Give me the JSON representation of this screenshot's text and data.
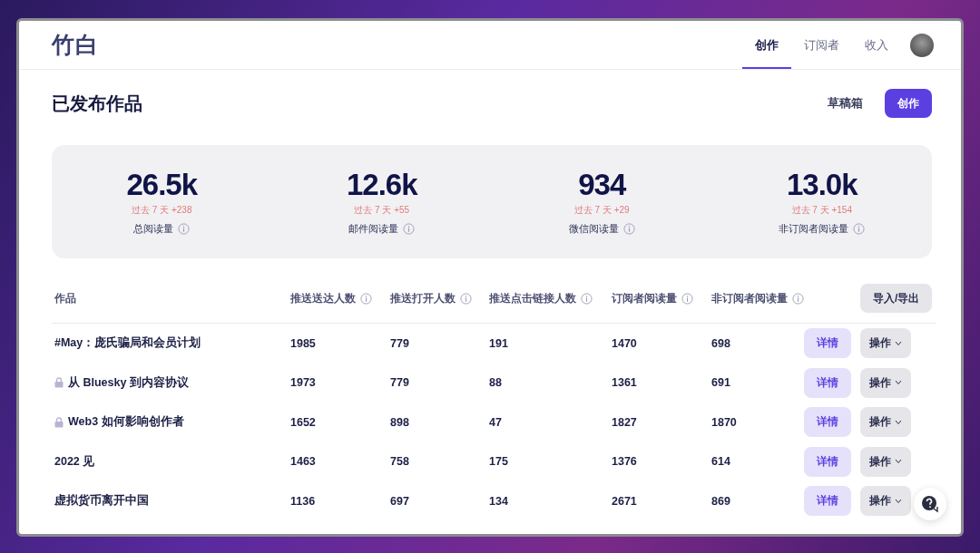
{
  "header": {
    "logo": "竹白",
    "nav": [
      {
        "label": "创作",
        "selected": true
      },
      {
        "label": "订阅者",
        "selected": false
      },
      {
        "label": "收入",
        "selected": false
      }
    ]
  },
  "page": {
    "title": "已发布作品",
    "drafts_link": "草稿箱",
    "create_button": "创作"
  },
  "stats": [
    {
      "value": "26.5k",
      "change": "过去 7 天 +238",
      "label": "总阅读量"
    },
    {
      "value": "12.6k",
      "change": "过去 7 天 +55",
      "label": "邮件阅读量"
    },
    {
      "value": "934",
      "change": "过去 7 天 +29",
      "label": "微信阅读量"
    },
    {
      "value": "13.0k",
      "change": "过去 7 天 +154",
      "label": "非订阅者阅读量"
    }
  ],
  "table": {
    "columns": [
      {
        "label": "作品",
        "info": false
      },
      {
        "label": "推送送达人数",
        "info": true
      },
      {
        "label": "推送打开人数",
        "info": true
      },
      {
        "label": "推送点击链接人数",
        "info": true
      },
      {
        "label": "订阅者阅读量",
        "info": true
      },
      {
        "label": "非订阅者阅读量",
        "info": true
      }
    ],
    "import_export_button": "导入/导出",
    "rows": [
      {
        "locked": false,
        "cells": [
          "#May：庞氏骗局和会员计划",
          "1985",
          "779",
          "191",
          "1470",
          "698"
        ],
        "details": "详情",
        "actions": "操作"
      },
      {
        "locked": true,
        "cells": [
          "从 Bluesky 到内容协议",
          "1973",
          "779",
          "88",
          "1361",
          "691"
        ],
        "details": "详情",
        "actions": "操作"
      },
      {
        "locked": true,
        "cells": [
          "Web3 如何影响创作者",
          "1652",
          "898",
          "47",
          "1827",
          "1870"
        ],
        "details": "详情",
        "actions": "操作"
      },
      {
        "locked": false,
        "cells": [
          "2022 见",
          "1463",
          "758",
          "175",
          "1376",
          "614"
        ],
        "details": "详情",
        "actions": "操作"
      },
      {
        "locked": false,
        "cells": [
          "虚拟货币离开中国",
          "1136",
          "697",
          "134",
          "2671",
          "869"
        ],
        "details": "详情",
        "actions": "操作"
      }
    ]
  }
}
